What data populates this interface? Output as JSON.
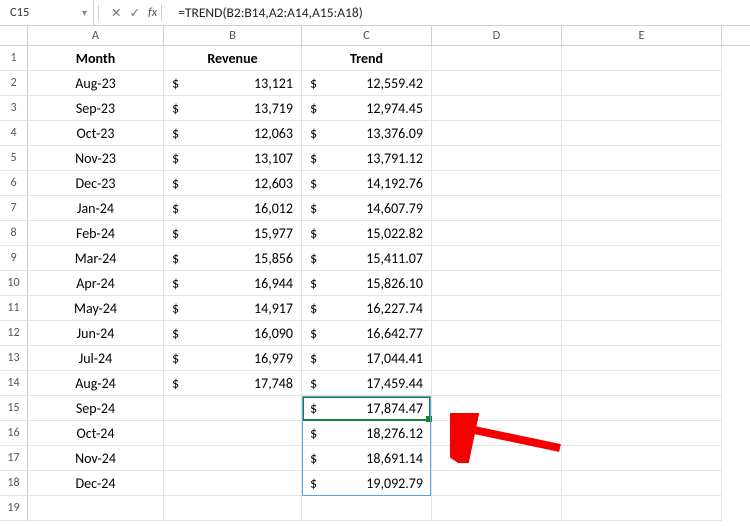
{
  "formula_bar": {
    "name_box": "C15",
    "fx_cancel": "✕",
    "fx_confirm": "✓",
    "fx_label": "fx",
    "formula": "=TREND(B2:B14,A2:A14,A15:A18)"
  },
  "columns": [
    "A",
    "B",
    "C",
    "D",
    "E"
  ],
  "rows": [
    {
      "n": "1",
      "month": "Month",
      "rev_sym": "",
      "rev": "Revenue",
      "trend_sym": "",
      "trend": "Trend",
      "header": true
    },
    {
      "n": "2",
      "month": "Aug-23",
      "rev_sym": "$",
      "rev": "13,121",
      "trend_sym": "$",
      "trend": "12,559.42"
    },
    {
      "n": "3",
      "month": "Sep-23",
      "rev_sym": "$",
      "rev": "13,719",
      "trend_sym": "$",
      "trend": "12,974.45"
    },
    {
      "n": "4",
      "month": "Oct-23",
      "rev_sym": "$",
      "rev": "12,063",
      "trend_sym": "$",
      "trend": "13,376.09"
    },
    {
      "n": "5",
      "month": "Nov-23",
      "rev_sym": "$",
      "rev": "13,107",
      "trend_sym": "$",
      "trend": "13,791.12"
    },
    {
      "n": "6",
      "month": "Dec-23",
      "rev_sym": "$",
      "rev": "12,603",
      "trend_sym": "$",
      "trend": "14,192.76"
    },
    {
      "n": "7",
      "month": "Jan-24",
      "rev_sym": "$",
      "rev": "16,012",
      "trend_sym": "$",
      "trend": "14,607.79"
    },
    {
      "n": "8",
      "month": "Feb-24",
      "rev_sym": "$",
      "rev": "15,977",
      "trend_sym": "$",
      "trend": "15,022.82"
    },
    {
      "n": "9",
      "month": "Mar-24",
      "rev_sym": "$",
      "rev": "15,856",
      "trend_sym": "$",
      "trend": "15,411.07"
    },
    {
      "n": "10",
      "month": "Apr-24",
      "rev_sym": "$",
      "rev": "16,944",
      "trend_sym": "$",
      "trend": "15,826.10"
    },
    {
      "n": "11",
      "month": "May-24",
      "rev_sym": "$",
      "rev": "14,917",
      "trend_sym": "$",
      "trend": "16,227.74"
    },
    {
      "n": "12",
      "month": "Jun-24",
      "rev_sym": "$",
      "rev": "16,090",
      "trend_sym": "$",
      "trend": "16,642.77"
    },
    {
      "n": "13",
      "month": "Jul-24",
      "rev_sym": "$",
      "rev": "16,979",
      "trend_sym": "$",
      "trend": "17,044.41"
    },
    {
      "n": "14",
      "month": "Aug-24",
      "rev_sym": "$",
      "rev": "17,748",
      "trend_sym": "$",
      "trend": "17,459.44"
    },
    {
      "n": "15",
      "month": "Sep-24",
      "rev_sym": "",
      "rev": "",
      "trend_sym": "$",
      "trend": "17,874.47"
    },
    {
      "n": "16",
      "month": "Oct-24",
      "rev_sym": "",
      "rev": "",
      "trend_sym": "$",
      "trend": "18,276.12"
    },
    {
      "n": "17",
      "month": "Nov-24",
      "rev_sym": "",
      "rev": "",
      "trend_sym": "$",
      "trend": "18,691.14"
    },
    {
      "n": "18",
      "month": "Dec-24",
      "rev_sym": "",
      "rev": "",
      "trend_sym": "$",
      "trend": "19,092.79"
    },
    {
      "n": "19",
      "month": "",
      "rev_sym": "",
      "rev": "",
      "trend_sym": "",
      "trend": ""
    }
  ],
  "chart_data": {
    "type": "table",
    "title": "Revenue and TREND projection",
    "columns": [
      "Month",
      "Revenue",
      "Trend"
    ],
    "rows": [
      [
        "Aug-23",
        13121,
        12559.42
      ],
      [
        "Sep-23",
        13719,
        12974.45
      ],
      [
        "Oct-23",
        12063,
        13376.09
      ],
      [
        "Nov-23",
        13107,
        13791.12
      ],
      [
        "Dec-23",
        12603,
        14192.76
      ],
      [
        "Jan-24",
        16012,
        14607.79
      ],
      [
        "Feb-24",
        15977,
        15022.82
      ],
      [
        "Mar-24",
        15856,
        15411.07
      ],
      [
        "Apr-24",
        16944,
        15826.1
      ],
      [
        "May-24",
        14917,
        16227.74
      ],
      [
        "Jun-24",
        16090,
        16642.77
      ],
      [
        "Jul-24",
        16979,
        17044.41
      ],
      [
        "Aug-24",
        17748,
        17459.44
      ],
      [
        "Sep-24",
        null,
        17874.47
      ],
      [
        "Oct-24",
        null,
        18276.12
      ],
      [
        "Nov-24",
        null,
        18691.14
      ],
      [
        "Dec-24",
        null,
        19092.79
      ]
    ]
  }
}
